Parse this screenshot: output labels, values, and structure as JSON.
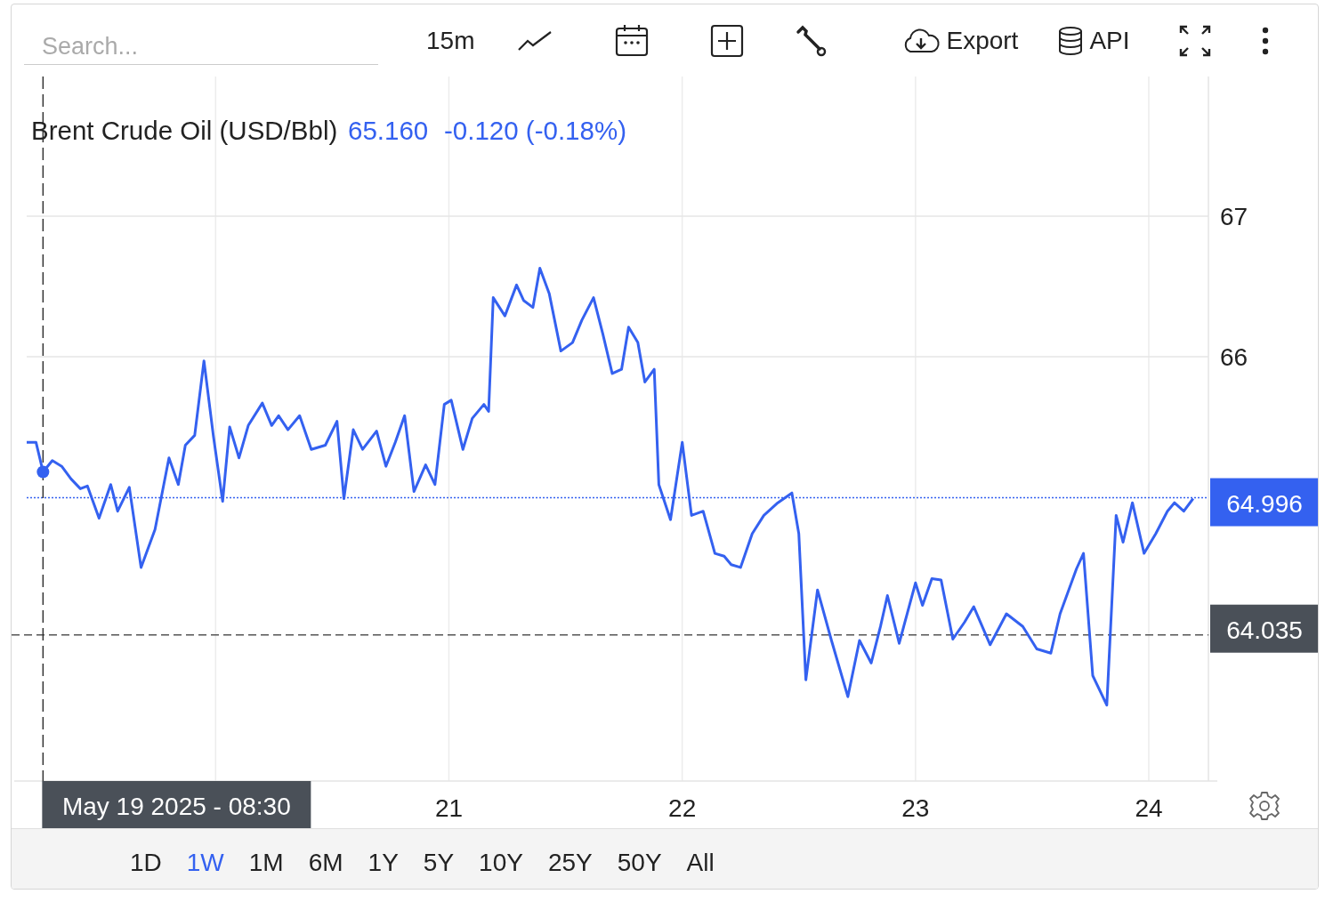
{
  "toolbar": {
    "search": {
      "placeholder": "Search..."
    },
    "interval": "15m",
    "export_label": "Export",
    "api_label": "API"
  },
  "chart": {
    "title": "Brent Crude Oil (USD/Bbl)",
    "price": "65.160",
    "change": "-0.120 (-0.18%)",
    "last_price_tag": "64.996",
    "crosshair_price_tag": "64.035",
    "crosshair_time": "May 19 2025 - 08:30",
    "chart_data": {
      "type": "line",
      "x": [
        19.19,
        19.23,
        19.26,
        19.3,
        19.34,
        19.38,
        19.42,
        19.45,
        19.5,
        19.55,
        19.58,
        19.63,
        19.68,
        19.74,
        19.8,
        19.84,
        19.87,
        19.91,
        19.95,
        19.99,
        20.03,
        20.06,
        20.1,
        20.14,
        20.2,
        20.24,
        20.27,
        20.31,
        20.36,
        20.41,
        20.47,
        20.52,
        20.55,
        20.59,
        20.63,
        20.69,
        20.73,
        20.77,
        20.81,
        20.85,
        20.9,
        20.94,
        20.98,
        21.01,
        21.06,
        21.1,
        21.15,
        21.17,
        21.19,
        21.24,
        21.29,
        21.32,
        21.36,
        21.39,
        21.43,
        21.48,
        21.53,
        21.57,
        21.62,
        21.66,
        21.7,
        21.74,
        21.77,
        21.81,
        21.84,
        21.88,
        21.9,
        21.95,
        22.0,
        22.04,
        22.09,
        22.14,
        22.18,
        22.21,
        22.25,
        22.3,
        22.35,
        22.41,
        22.47,
        22.5,
        22.53,
        22.58,
        22.64,
        22.71,
        22.76,
        22.81,
        22.85,
        22.88,
        22.93,
        23.0,
        23.03,
        23.07,
        23.11,
        23.16,
        23.21,
        23.25,
        23.32,
        23.39,
        23.46,
        23.52,
        23.58,
        23.62,
        23.69,
        23.72,
        23.76,
        23.82,
        23.86,
        23.89,
        23.93,
        23.98,
        24.03,
        24.08,
        24.11,
        24.15,
        24.19
      ],
      "series": [
        {
          "color": "#3461f0",
          "values": [
            65.39,
            65.39,
            65.18,
            65.26,
            65.22,
            65.13,
            65.06,
            65.08,
            64.85,
            65.09,
            64.9,
            65.07,
            64.5,
            64.77,
            65.28,
            65.09,
            65.37,
            65.44,
            65.97,
            65.44,
            64.97,
            65.5,
            65.28,
            65.51,
            65.67,
            65.51,
            65.58,
            65.48,
            65.58,
            65.34,
            65.37,
            65.54,
            64.99,
            65.48,
            65.34,
            65.47,
            65.22,
            65.39,
            65.58,
            65.04,
            65.23,
            65.09,
            65.66,
            65.69,
            65.34,
            65.56,
            65.66,
            65.61,
            66.42,
            66.29,
            66.51,
            66.4,
            66.35,
            66.63,
            66.45,
            66.04,
            66.1,
            66.26,
            66.42,
            66.16,
            65.88,
            65.91,
            66.21,
            66.1,
            65.82,
            65.91,
            65.09,
            64.84,
            65.39,
            64.87,
            64.9,
            64.6,
            64.58,
            64.52,
            64.5,
            64.74,
            64.87,
            64.96,
            65.03,
            64.74,
            63.7,
            64.34,
            63.98,
            63.58,
            63.98,
            63.82,
            64.08,
            64.3,
            63.96,
            64.39,
            64.23,
            64.42,
            64.41,
            63.99,
            64.11,
            64.22,
            63.95,
            64.17,
            64.08,
            63.92,
            63.89,
            64.17,
            64.49,
            64.6,
            63.73,
            63.52,
            64.87,
            64.68,
            64.96,
            64.6,
            64.74,
            64.9,
            64.96,
            64.9,
            64.99
          ]
        }
      ],
      "xlim": [
        19.19,
        24.25
      ],
      "ylim": [
        62.98,
        68.0
      ],
      "xticks": [
        {
          "value": 21,
          "label": "21"
        },
        {
          "value": 22,
          "label": "22"
        },
        {
          "value": 23,
          "label": "23"
        },
        {
          "value": 24,
          "label": "24"
        }
      ],
      "yticks": [
        66,
        67
      ],
      "grid": true,
      "ref_lines": [
        {
          "axis": "y",
          "value": 64.996,
          "color": "#3461f0"
        },
        {
          "axis": "y",
          "value": 64.02,
          "color": "#555555"
        },
        {
          "axis": "x",
          "value": 19.26,
          "color": "#333333"
        }
      ]
    }
  },
  "ranges": [
    {
      "label": "1D",
      "selected": false
    },
    {
      "label": "1W",
      "selected": true
    },
    {
      "label": "1M",
      "selected": false
    },
    {
      "label": "6M",
      "selected": false
    },
    {
      "label": "1Y",
      "selected": false
    },
    {
      "label": "5Y",
      "selected": false
    },
    {
      "label": "10Y",
      "selected": false
    },
    {
      "label": "25Y",
      "selected": false
    },
    {
      "label": "50Y",
      "selected": false
    },
    {
      "label": "All",
      "selected": false
    }
  ]
}
